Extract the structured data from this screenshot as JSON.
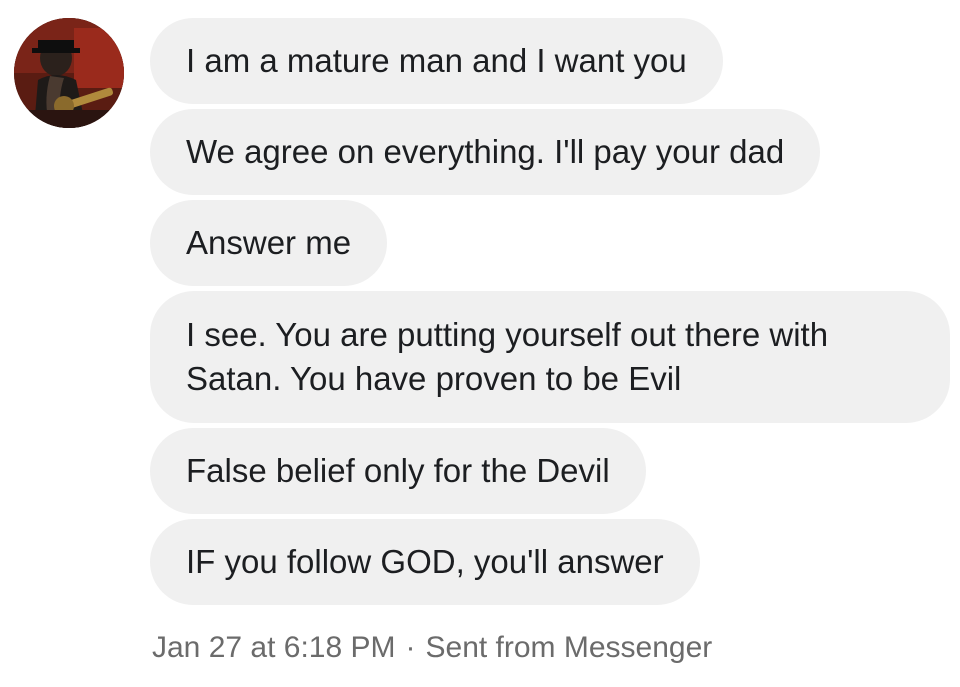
{
  "sender": {
    "avatar_icon": "profile-photo-avatar"
  },
  "messages": [
    {
      "text": "I am a mature man and I want you"
    },
    {
      "text": "We agree on everything. I'll pay your dad"
    },
    {
      "text": "Answer me"
    },
    {
      "text": "I see. You are putting yourself out there with Satan. You have proven to be Evil"
    },
    {
      "text": "False belief only for the Devil"
    },
    {
      "text": "IF you follow GOD, you'll answer"
    }
  ],
  "footer": {
    "timestamp": "Jan 27 at 6:18 PM",
    "separator": "·",
    "source": "Sent from Messenger"
  },
  "colors": {
    "bubble_bg": "#f0f0f0",
    "text": "#1c1e21",
    "meta_text": "#6b6b6b"
  }
}
